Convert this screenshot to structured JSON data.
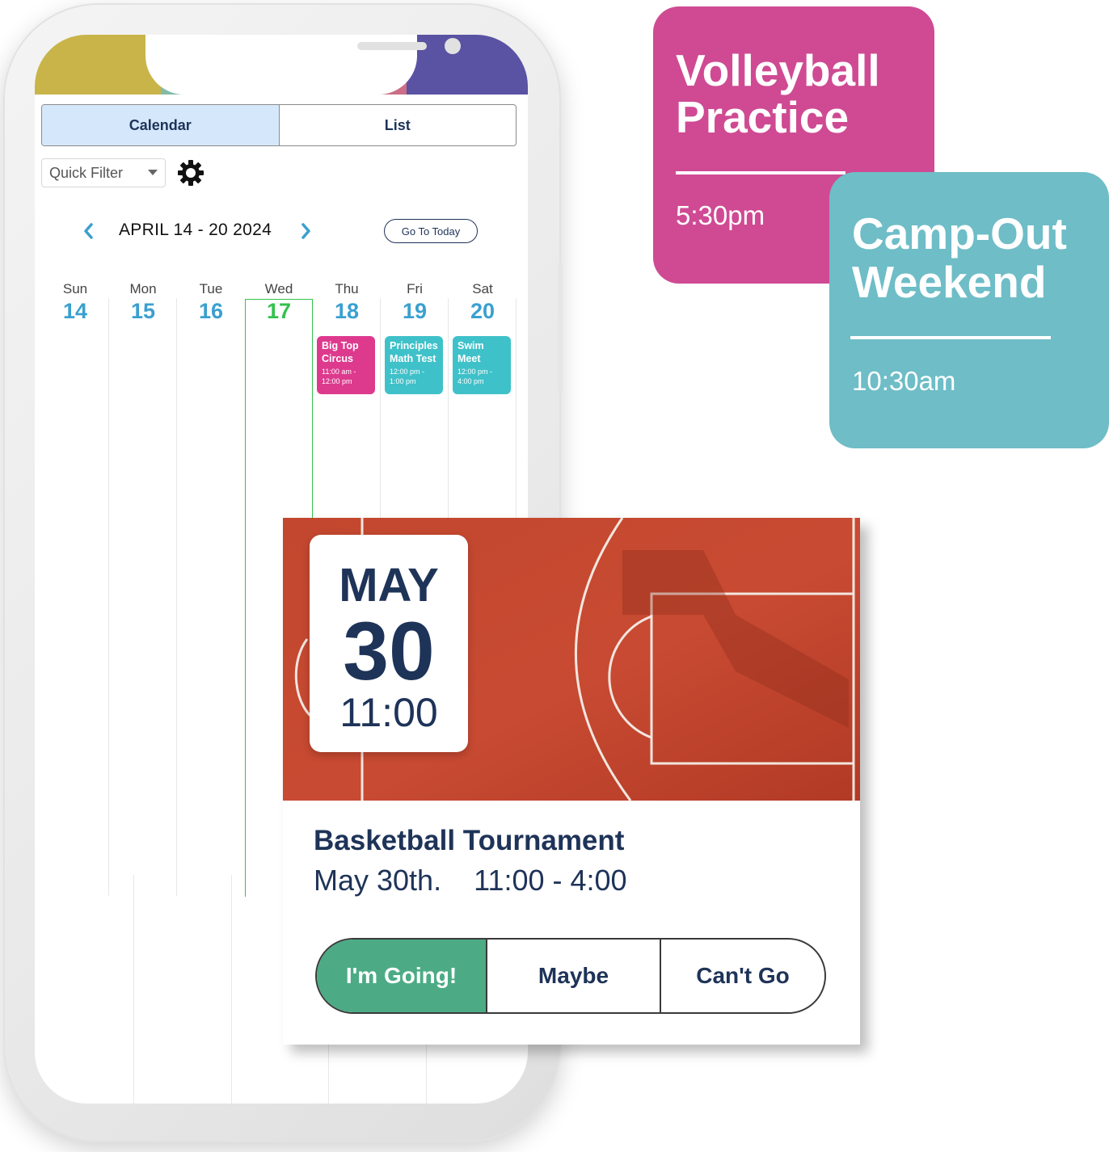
{
  "colors": {
    "tab_gold": "#c9b44a",
    "tab_green": "#82bca6",
    "tab_rose": "#cb6e87",
    "tab_purple": "#5a52a2",
    "pink": "#cf4a93",
    "teal": "#6ebdc7",
    "today_green": "#33c24d",
    "going_green": "#4cab85",
    "navy": "#1e3358"
  },
  "phone": {
    "view_tabs": {
      "calendar": "Calendar",
      "list": "List",
      "active": "Calendar"
    },
    "quick_filter": {
      "value": "Quick Filter"
    },
    "week": {
      "label": "APRIL 14 - 20 2024",
      "go_today": "Go To Today"
    },
    "days": [
      {
        "dow": "Sun",
        "num": "14"
      },
      {
        "dow": "Mon",
        "num": "15"
      },
      {
        "dow": "Tue",
        "num": "16"
      },
      {
        "dow": "Wed",
        "num": "17",
        "today": true
      },
      {
        "dow": "Thu",
        "num": "18"
      },
      {
        "dow": "Fri",
        "num": "19"
      },
      {
        "dow": "Sat",
        "num": "20"
      }
    ],
    "events": [
      {
        "day": "Thu",
        "title": "Big Top Circus",
        "time": "11:00 am - 12:00 pm",
        "color": "#dd3a8e"
      },
      {
        "day": "Fri",
        "title": "Principles Math Test",
        "time": "12:00 pm - 1:00 pm",
        "color": "#3fc1c9"
      },
      {
        "day": "Sat",
        "title": "Swim Meet",
        "time": "12:00 pm - 4:00 pm",
        "color": "#3fc1c9"
      }
    ]
  },
  "cards": {
    "volleyball": {
      "title": "Volleyball Practice",
      "time": "5:30pm"
    },
    "campout": {
      "title": "Camp-Out Weekend",
      "time": "10:30am"
    }
  },
  "event_detail": {
    "badge": {
      "month": "MAY",
      "day": "30",
      "time": "11:00"
    },
    "title": "Basketball Tournament",
    "date_line": "May 30th.    11:00 - 4:00",
    "rsvp": {
      "going": "I'm Going!",
      "maybe": "Maybe",
      "cant": "Can't Go",
      "selected": "going"
    }
  }
}
